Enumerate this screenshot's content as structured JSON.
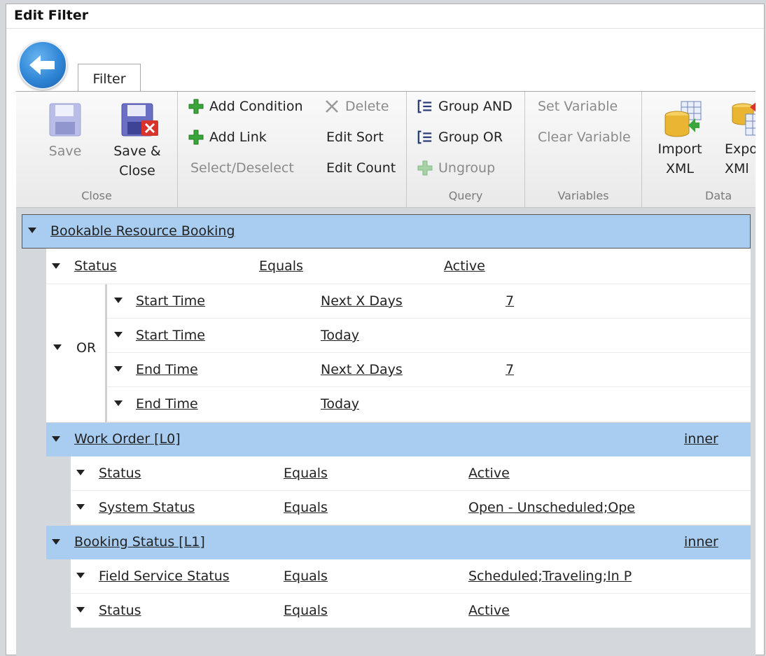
{
  "window": {
    "title": "Edit Filter"
  },
  "tab": {
    "label": "Filter"
  },
  "ribbon": {
    "close_group": {
      "label": "Close",
      "save": "Save",
      "save_close_1": "Save &",
      "save_close_2": "Close"
    },
    "edit_group": {
      "add_condition": "Add Condition",
      "add_link": "Add Link",
      "select_deselect": "Select/Deselect",
      "delete": "Delete",
      "edit_sort": "Edit Sort",
      "edit_count": "Edit Count"
    },
    "query_group": {
      "label": "Query",
      "group_and": "Group AND",
      "group_or": "Group OR",
      "ungroup": "Ungroup"
    },
    "variables_group": {
      "label": "Variables",
      "set_variable": "Set Variable",
      "clear_variable": "Clear Variable"
    },
    "data_group": {
      "label": "Data",
      "import_1": "Import",
      "import_2": "XML",
      "export_1": "Expo",
      "export_2": "XMl"
    }
  },
  "filter": {
    "root": {
      "entity": "Bookable Resource Booking"
    },
    "root_condition": {
      "field": "Status",
      "operator": "Equals",
      "value": "Active"
    },
    "or_group": {
      "label": "OR",
      "conditions": [
        {
          "field": "Start Time",
          "operator": "Next X Days",
          "value": "7"
        },
        {
          "field": "Start Time",
          "operator": "Today",
          "value": ""
        },
        {
          "field": "End Time",
          "operator": "Next X Days",
          "value": "7"
        },
        {
          "field": "End Time",
          "operator": "Today",
          "value": ""
        }
      ]
    },
    "link1": {
      "entity": "Work Order [L0]",
      "join": "inner",
      "conditions": [
        {
          "field": "Status",
          "operator": "Equals",
          "value": "Active"
        },
        {
          "field": "System Status",
          "operator": "Equals",
          "value": "Open - Unscheduled;Ope"
        }
      ]
    },
    "link2": {
      "entity": "Booking Status [L1]",
      "join": "inner",
      "conditions": [
        {
          "field": "Field Service Status",
          "operator": "Equals",
          "value": "Scheduled;Traveling;In P"
        },
        {
          "field": "Status",
          "operator": "Equals",
          "value": "Active"
        }
      ]
    }
  }
}
